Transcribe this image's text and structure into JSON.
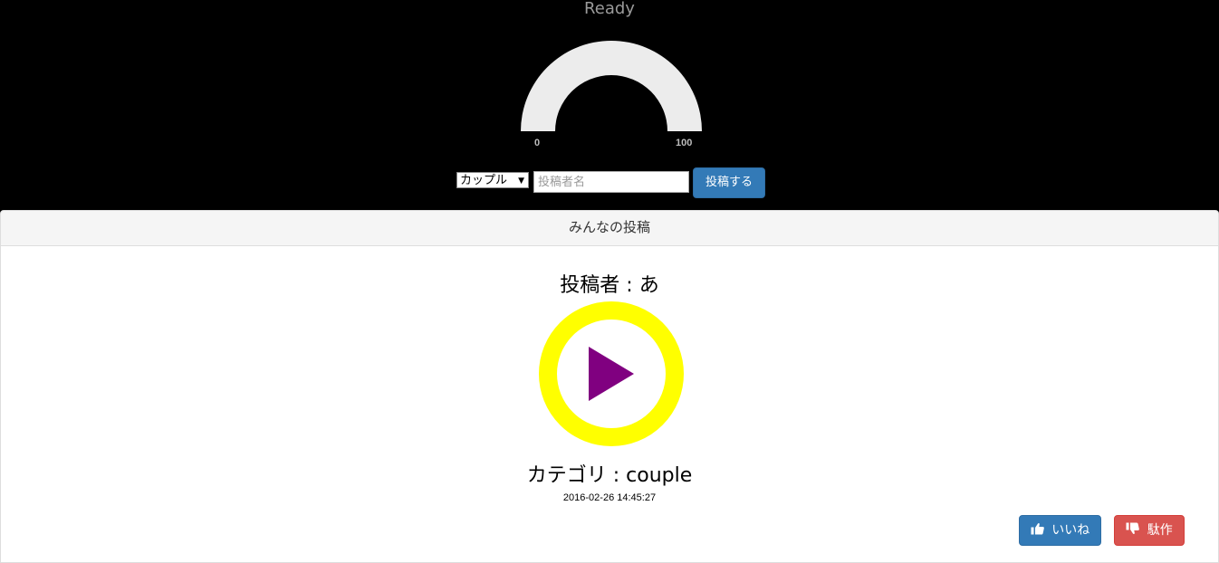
{
  "header": {
    "status": "Ready"
  },
  "gauge": {
    "min_label": "0",
    "max_label": "100",
    "value": 0,
    "track_color": "#ececec"
  },
  "form": {
    "category_selected": "カップル",
    "poster_placeholder": "投稿者名",
    "poster_value": "",
    "submit_label": "投稿する"
  },
  "panel": {
    "title": "みんなの投稿"
  },
  "post": {
    "poster_line": "投稿者 : あ",
    "category_line": "カテゴリ : couple",
    "timestamp": "2016-02-26 14:45:27",
    "play_ring_color": "#ffff00",
    "play_triangle_color": "#800080"
  },
  "actions": {
    "like_label": "いいね",
    "dislike_label": "駄作",
    "like_icon": "thumbs-up-icon",
    "dislike_icon": "thumbs-down-icon"
  }
}
